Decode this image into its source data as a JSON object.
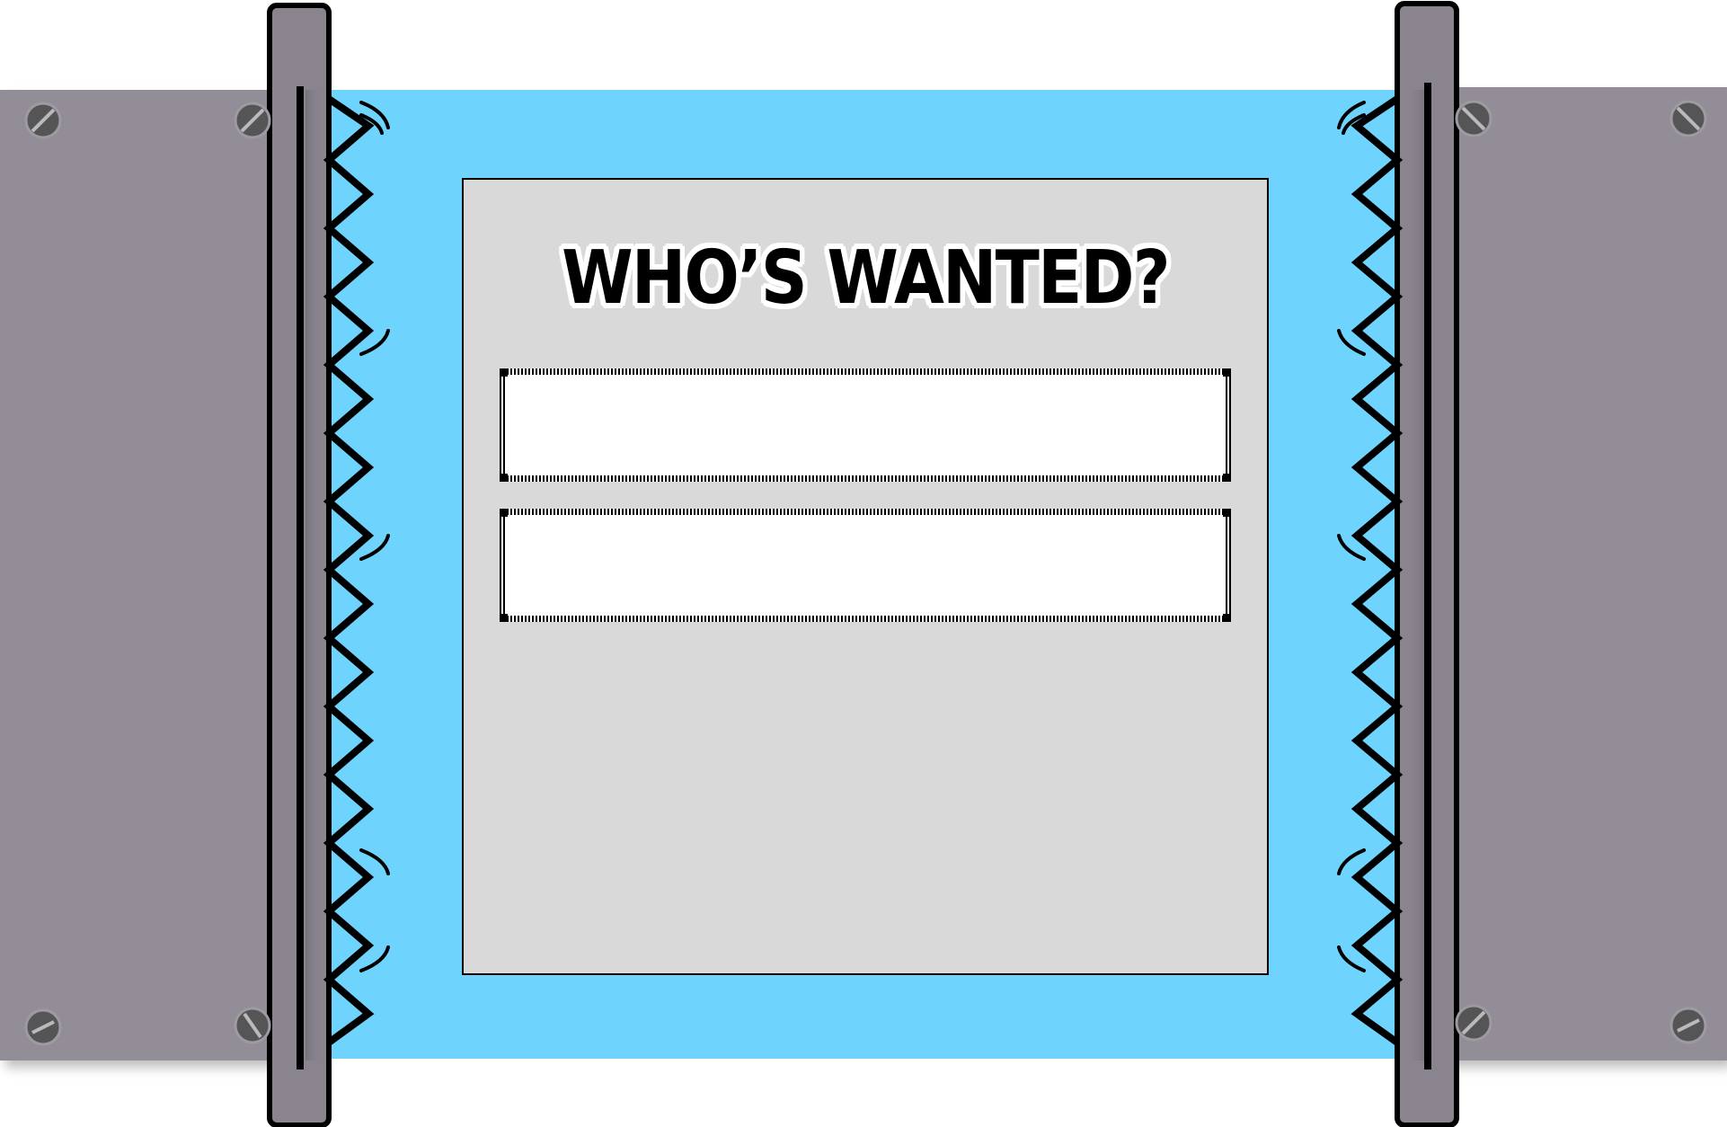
{
  "game": {
    "prompt_title": "WHO’S WANTED?",
    "inputs": [
      {
        "value": "",
        "placeholder": ""
      },
      {
        "value": "",
        "placeholder": ""
      }
    ]
  },
  "colors": {
    "background": "#6fd4fd",
    "metal_plate": "#938d98",
    "metal_bar": "#8a848e",
    "screw": "#555555",
    "panel": "#d9d9d9",
    "outline": "#000000"
  },
  "icons": [
    "screw-icon",
    "zigzag-spring-icon",
    "wobble-mark-icon"
  ]
}
